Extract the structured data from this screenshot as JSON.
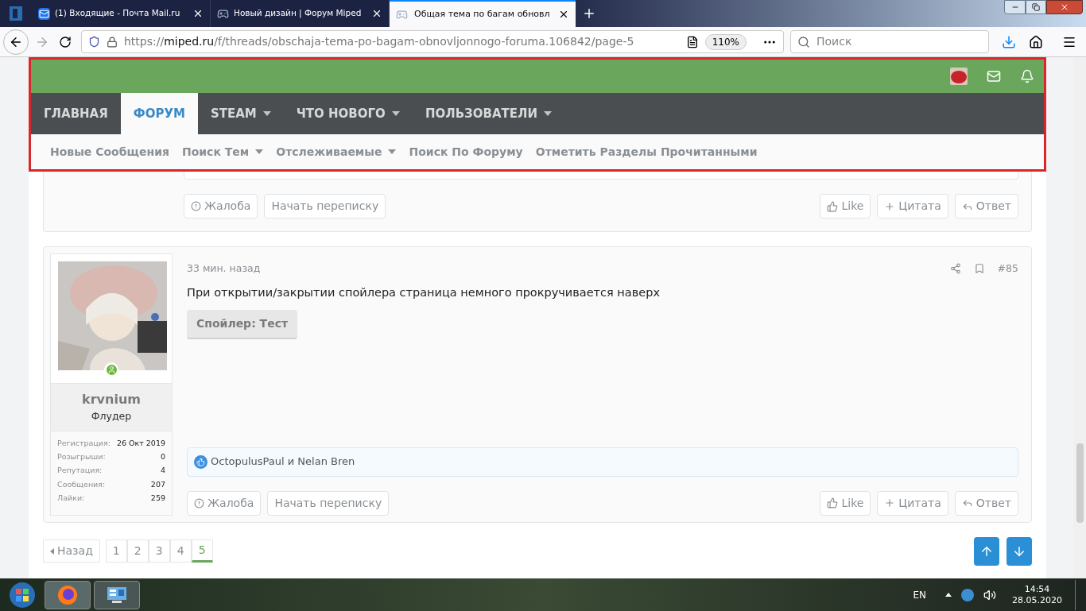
{
  "browser": {
    "tabs": [
      {
        "title": "(1) Входящие - Почта Mail.ru",
        "selected": false
      },
      {
        "title": "Новый дизайн | Форум Miped",
        "selected": false
      },
      {
        "title": "Общая тема по багам обновл",
        "selected": true
      }
    ],
    "url": {
      "scheme": "https://",
      "domain": "miped.ru",
      "path": "/f/threads/obschaja-tema-po-bagam-obnovljonnogo-foruma.106842/page-5"
    },
    "zoom": "110%",
    "search_placeholder": "Поиск"
  },
  "nav": [
    {
      "label": "ГЛАВНАЯ",
      "selected": false,
      "dropdown": false
    },
    {
      "label": "ФОРУМ",
      "selected": true,
      "dropdown": false
    },
    {
      "label": "STEAM",
      "selected": false,
      "dropdown": true
    },
    {
      "label": "ЧТО НОВОГО",
      "selected": false,
      "dropdown": true
    },
    {
      "label": "ПОЛЬЗОВАТЕЛИ",
      "selected": false,
      "dropdown": true
    }
  ],
  "subnav": [
    {
      "label": "Новые Сообщения",
      "dropdown": false
    },
    {
      "label": "Поиск Тем",
      "dropdown": true
    },
    {
      "label": "Отслеживаемые",
      "dropdown": true
    },
    {
      "label": "Поиск По Форуму",
      "dropdown": false
    },
    {
      "label": "Отметить Разделы Прочитанными",
      "dropdown": false
    }
  ],
  "previous_post": {
    "actions_left": [
      "Жалоба",
      "Начать переписку"
    ],
    "actions_right": [
      "Like",
      "Цитата",
      "Ответ"
    ]
  },
  "post": {
    "time": "33 мин. назад",
    "number": "#85",
    "text": "При открытии/закрытии спойлера страница немного прокручивается наверх",
    "spoiler": "Спойлер: Тест",
    "user": {
      "name": "krvnium",
      "title": "Флудер",
      "online": true,
      "stats": [
        {
          "label": "Регистрация:",
          "value": "26 Окт 2019"
        },
        {
          "label": "Розыгрыши:",
          "value": "0"
        },
        {
          "label": "Репутация:",
          "value": "4"
        },
        {
          "label": "Сообщения:",
          "value": "207"
        },
        {
          "label": "Лайки:",
          "value": "259"
        }
      ]
    },
    "reactions": "OctopulusPaul и Nelan Bren",
    "actions_left": [
      "Жалоба",
      "Начать переписку"
    ],
    "actions_right": [
      "Like",
      "Цитата",
      "Ответ"
    ]
  },
  "pagination": {
    "prev": "Назад",
    "pages": [
      {
        "label": "1",
        "selected": false
      },
      {
        "label": "2",
        "selected": false
      },
      {
        "label": "3",
        "selected": false
      },
      {
        "label": "4",
        "selected": false
      },
      {
        "label": "5",
        "selected": true
      }
    ]
  },
  "taskbar": {
    "language": "EN",
    "time": "14:54",
    "date": "28.05.2020"
  }
}
